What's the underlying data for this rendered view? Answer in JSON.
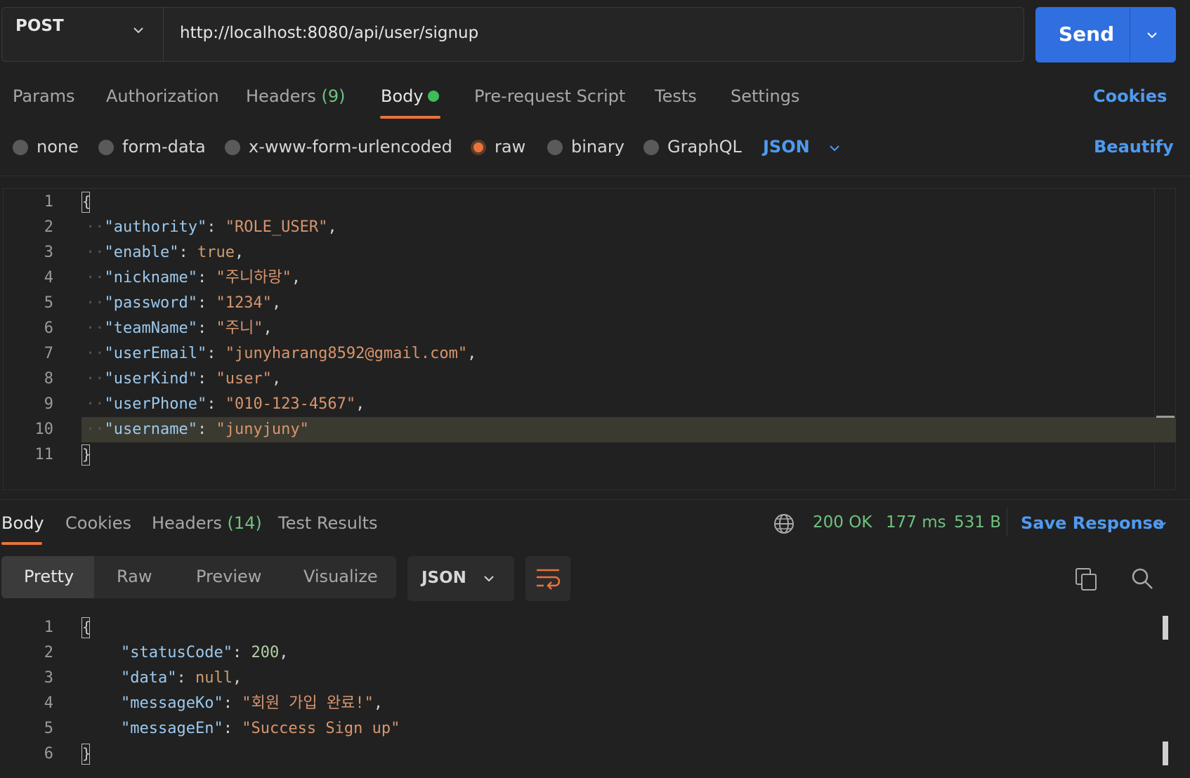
{
  "request": {
    "method": "POST",
    "url": "http://localhost:8080/api/user/signup",
    "send_label": "Send"
  },
  "request_tabs": {
    "params": "Params",
    "authorization": "Authorization",
    "headers": "Headers",
    "headers_count": "(9)",
    "body": "Body",
    "prerequest": "Pre-request Script",
    "tests": "Tests",
    "settings": "Settings",
    "cookies": "Cookies"
  },
  "body_types": {
    "none": "none",
    "form_data": "form-data",
    "urlencoded": "x-www-form-urlencoded",
    "raw": "raw",
    "binary": "binary",
    "graphql": "GraphQL",
    "selected": "raw",
    "language": "JSON",
    "beautify": "Beautify"
  },
  "request_body": {
    "line_numbers": [
      "1",
      "2",
      "3",
      "4",
      "5",
      "6",
      "7",
      "8",
      "9",
      "10",
      "11"
    ],
    "open": "{",
    "close": "}",
    "lines": [
      {
        "key": "\"authority\"",
        "value": "\"ROLE_USER\"",
        "sep": ",",
        "type": "s"
      },
      {
        "key": "\"enable\"",
        "value": "true",
        "sep": ",",
        "type": "b"
      },
      {
        "key": "\"nickname\"",
        "value": "\"주니하랑\"",
        "sep": ",",
        "type": "s"
      },
      {
        "key": "\"password\"",
        "value": "\"1234\"",
        "sep": ",",
        "type": "s"
      },
      {
        "key": "\"teamName\"",
        "value": "\"주니\"",
        "sep": ",",
        "type": "s"
      },
      {
        "key": "\"userEmail\"",
        "value": "\"junyharang8592@gmail.com\"",
        "sep": ",",
        "type": "s"
      },
      {
        "key": "\"userKind\"",
        "value": "\"user\"",
        "sep": ",",
        "type": "s"
      },
      {
        "key": "\"userPhone\"",
        "value": "\"010-123-4567\"",
        "sep": ",",
        "type": "s"
      },
      {
        "key": "\"username\"",
        "value": "\"junyjuny\"",
        "sep": "",
        "type": "s"
      }
    ]
  },
  "response_tabs": {
    "body": "Body",
    "cookies": "Cookies",
    "headers": "Headers",
    "headers_count": "(14)",
    "test_results": "Test Results"
  },
  "response_status": {
    "status": "200 OK",
    "time": "177 ms",
    "size": "531 B",
    "save_response": "Save Response"
  },
  "response_view": {
    "pretty": "Pretty",
    "raw": "Raw",
    "preview": "Preview",
    "visualize": "Visualize",
    "format": "JSON"
  },
  "response_body": {
    "line_numbers": [
      "1",
      "2",
      "3",
      "4",
      "5",
      "6"
    ],
    "open": "{",
    "close": "}",
    "lines": [
      {
        "key": "\"statusCode\"",
        "value": "200",
        "sep": ",",
        "type": "n"
      },
      {
        "key": "\"data\"",
        "value": "null",
        "sep": ",",
        "type": "b"
      },
      {
        "key": "\"messageKo\"",
        "value": "\"회원 가입 완료!\"",
        "sep": ",",
        "type": "s"
      },
      {
        "key": "\"messageEn\"",
        "value": "\"Success Sign up\"",
        "sep": "",
        "type": "s"
      }
    ]
  },
  "colors": {
    "accent": "#2f6fe0",
    "tab_indicator": "#e8743b",
    "success": "#6fc181",
    "link": "#4f9af0"
  }
}
